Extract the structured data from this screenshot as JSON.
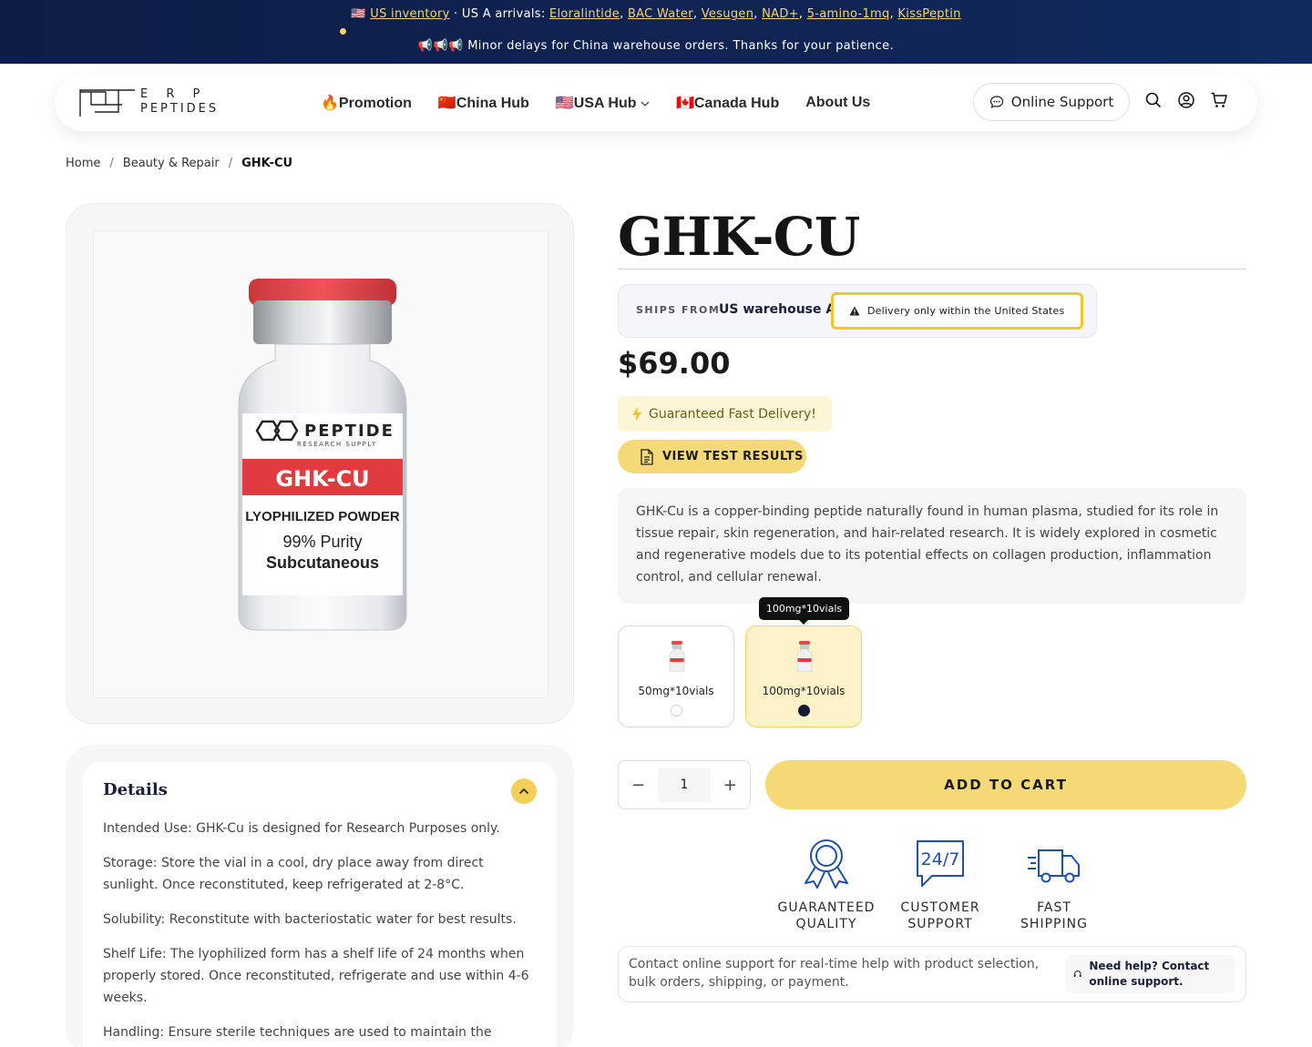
{
  "announcement": {
    "flag": "🇺🇸",
    "inventory_link": "US inventory",
    "arrivals_prefix": " · US A arrivals: ",
    "arrivals": [
      "Eloralintide",
      "BAC Water",
      "Vesugen",
      "NAD+",
      "5-amino-1mq",
      "KissPeptin"
    ],
    "delay_icons": "📢📢📢",
    "delay_text": "Minor delays for China warehouse orders. Thanks for your patience."
  },
  "header": {
    "logo_line1": "E R P",
    "logo_line2": "PEPTIDES",
    "nav": [
      {
        "icon": "🔥",
        "label": "Promotion"
      },
      {
        "icon": "🇨🇳",
        "label": "China Hub"
      },
      {
        "icon": "🇺🇸",
        "label": "USA Hub"
      },
      {
        "icon": "🇨🇦",
        "label": "Canada Hub"
      },
      {
        "icon": "",
        "label": "About Us"
      }
    ],
    "support_label": "Online Support"
  },
  "breadcrumb": [
    "Home",
    "Beauty & Repair",
    "GHK-CU"
  ],
  "product_image": {
    "brand": "PEPTIDE",
    "brand_sub": "RESEARCH SUPPLY",
    "name": "GHK-CU",
    "form": "LYOPHILIZED POWDER",
    "purity": "99% Purity",
    "route": "Subcutaneous"
  },
  "details": {
    "title": "Details",
    "paragraphs": [
      "Intended Use: GHK-Cu is designed for Research Purposes only.",
      "Storage: Store the vial in a cool, dry place away from direct sunlight. Once reconstituted, keep refrigerated at 2-8°C.",
      "Solubility: Reconstitute with bacteriostatic water for best results.",
      "Shelf Life: The lyophilized form has a shelf life of 24 months when properly stored. Once reconstituted, refrigerate and use within 4-6 weeks.",
      "Handling: Ensure sterile techniques are used to maintain the"
    ]
  },
  "product": {
    "title": "GHK-CU",
    "ships_from_label": "SHIPS FROM",
    "ships_from_value": "US warehouse A",
    "delivery_warning": "Delivery only within the United States",
    "price": "$69.00",
    "fast_delivery": "Guaranteed Fast Delivery!",
    "test_results": "VIEW TEST RESULTS",
    "description": "GHK-Cu is a copper-binding peptide naturally found in human plasma, studied for its role in tissue repair, skin regeneration, and hair-related research. It is widely explored in cosmetic and regenerative models due to its potential effects on collagen production, inflammation control, and cellular renewal.",
    "tooltip": "100mg*10vials",
    "variants": [
      {
        "label": "50mg*10vials",
        "selected": false
      },
      {
        "label": "100mg*10vials",
        "selected": true
      }
    ],
    "quantity": "1",
    "qty_minus": "−",
    "qty_plus": "+",
    "add_to_cart": "ADD TO CART"
  },
  "features": [
    {
      "icon": "award-ribbon-icon",
      "line1": "GUARANTEED",
      "line2": "QUALITY"
    },
    {
      "icon": "chat-24-7-icon",
      "line1": "CUSTOMER",
      "line2": "SUPPORT"
    },
    {
      "icon": "delivery-truck-icon",
      "line1": "FAST",
      "line2": "SHIPPING"
    }
  ],
  "help": {
    "text": "Contact online support for real-time help with product selection, bulk orders, shipping, or payment.",
    "pill": "Need help? Contact online support."
  },
  "colors": {
    "navy": "#0e1d47",
    "accent_yellow": "#f5d977",
    "label_red": "#e23b3f"
  }
}
